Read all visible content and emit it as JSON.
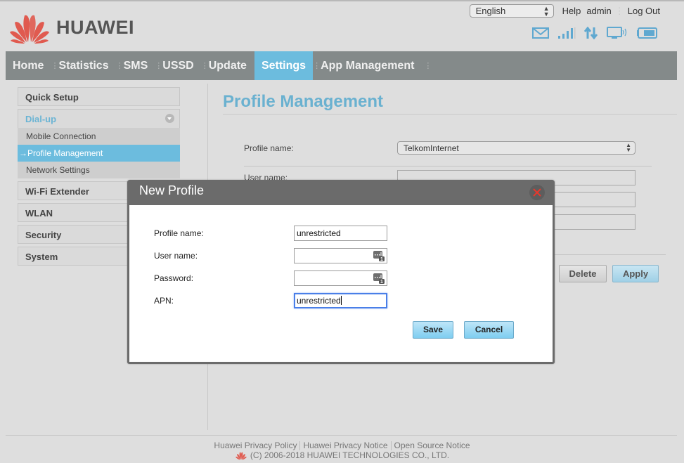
{
  "header": {
    "brand": "HUAWEI",
    "language": "English",
    "links": {
      "help": "Help",
      "user": "admin",
      "logout": "Log Out"
    },
    "status_icons": [
      "mail-icon",
      "signal-strength-icon",
      "data-transfer-icon",
      "wifi-device-icon",
      "battery-icon"
    ]
  },
  "nav": {
    "items": [
      "Home",
      "Statistics",
      "SMS",
      "USSD",
      "Update",
      "Settings",
      "App Management"
    ],
    "active": "Settings"
  },
  "sidebar": {
    "items": [
      {
        "label": "Quick Setup"
      },
      {
        "label": "Dial-up",
        "expanded": true,
        "children": [
          {
            "label": "Mobile Connection"
          },
          {
            "label": "→Profile Management",
            "active": true
          },
          {
            "label": "Network Settings"
          }
        ]
      },
      {
        "label": "Wi-Fi Extender"
      },
      {
        "label": "WLAN"
      },
      {
        "label": "Security"
      },
      {
        "label": "System"
      }
    ]
  },
  "main": {
    "title": "Profile Management",
    "profile_label": "Profile name:",
    "profile_value": "TelkomInternet",
    "username_label": "User name:",
    "delete_label": "Delete",
    "apply_label": "Apply"
  },
  "dialog": {
    "title": "New Profile",
    "fields": [
      {
        "label": "Profile name:",
        "value": "unrestricted"
      },
      {
        "label": "User name:",
        "value": ""
      },
      {
        "label": "Password:",
        "value": ""
      },
      {
        "label": "APN:",
        "value": "unrestricted"
      }
    ],
    "save_label": "Save",
    "cancel_label": "Cancel"
  },
  "footer": {
    "links": [
      "Huawei Privacy Policy",
      "Huawei Privacy Notice",
      "Open Source Notice"
    ],
    "copyright": "(C) 2006-2018 HUAWEI TECHNOLOGIES CO., LTD."
  },
  "colors": {
    "accent": "#6cbcde",
    "nav_bg": "#848a8a",
    "title": "#6ab1d0",
    "logo_red": "#e05a4f"
  }
}
